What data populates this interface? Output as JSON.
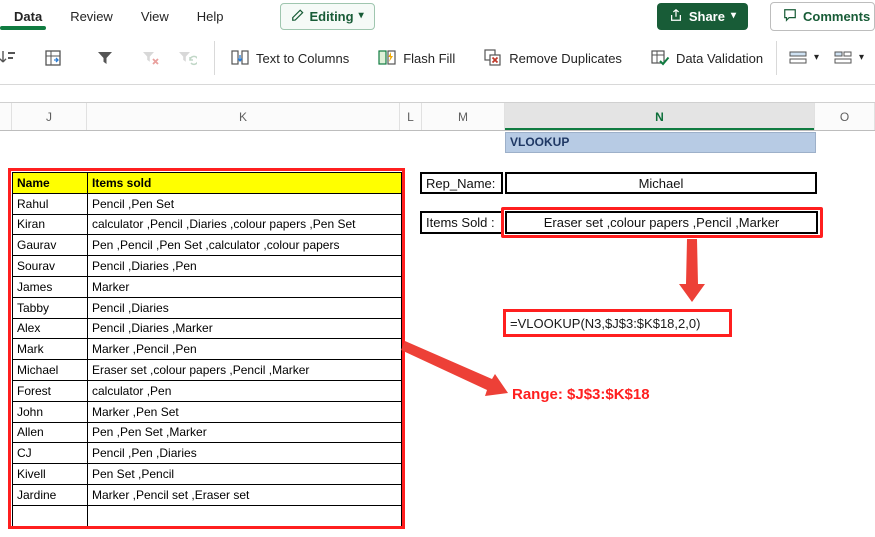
{
  "ribbon": {
    "tabs": [
      {
        "label": "Data",
        "active": true
      },
      {
        "label": "Review",
        "active": false
      },
      {
        "label": "View",
        "active": false
      },
      {
        "label": "Help",
        "active": false
      }
    ],
    "editing_label": "Editing",
    "share_label": "Share",
    "comments_label": "Comments"
  },
  "toolbar": {
    "text_to_columns": "Text to Columns",
    "flash_fill": "Flash Fill",
    "remove_duplicates": "Remove Duplicates",
    "data_validation": "Data Validation"
  },
  "sheet": {
    "columns": [
      "J",
      "K",
      "L",
      "M",
      "N",
      "O"
    ],
    "active_column": "N",
    "title_cell": "VLOOKUP",
    "table": {
      "headers": [
        "Name",
        "Items sold"
      ],
      "rows": [
        [
          "Rahul",
          "Pencil ,Pen Set"
        ],
        [
          "Kiran",
          "calculator ,Pencil ,Diaries ,colour papers ,Pen Set"
        ],
        [
          "Gaurav",
          "Pen ,Pencil ,Pen Set ,calculator ,colour papers"
        ],
        [
          "Sourav",
          "Pencil ,Diaries ,Pen"
        ],
        [
          "James",
          "Marker"
        ],
        [
          "Tabby",
          "Pencil ,Diaries"
        ],
        [
          "Alex",
          "Pencil ,Diaries ,Marker"
        ],
        [
          "Mark",
          "Marker ,Pencil ,Pen"
        ],
        [
          "Michael",
          "Eraser set ,colour papers ,Pencil ,Marker"
        ],
        [
          "Forest",
          "calculator ,Pen"
        ],
        [
          "John",
          "Marker ,Pen Set"
        ],
        [
          "Allen",
          "Pen ,Pen Set ,Marker"
        ],
        [
          "CJ",
          "Pencil ,Pen ,Diaries"
        ],
        [
          "Kivell",
          "Pen Set ,Pencil"
        ],
        [
          "Jardine",
          "Marker ,Pencil set ,Eraser set"
        ],
        [
          "",
          ""
        ]
      ]
    },
    "rep_name": {
      "label": "Rep_Name:",
      "value": "Michael"
    },
    "items_sold": {
      "label": "Items Sold :",
      "value": "Eraser set ,colour papers ,Pencil ,Marker"
    },
    "formula": "=VLOOKUP(N3,$J$3:$K$18,2,0)",
    "range_note": "Range: $J$3:$K$18"
  },
  "colors": {
    "excel_green": "#107C41",
    "share_button_green": "#185C37",
    "annotation_arrow_red": "#ED4037",
    "highlight_red": "#FF1F1F",
    "table_header_yellow": "#FFFF00",
    "title_cell_blue": "#B7CBE4"
  }
}
